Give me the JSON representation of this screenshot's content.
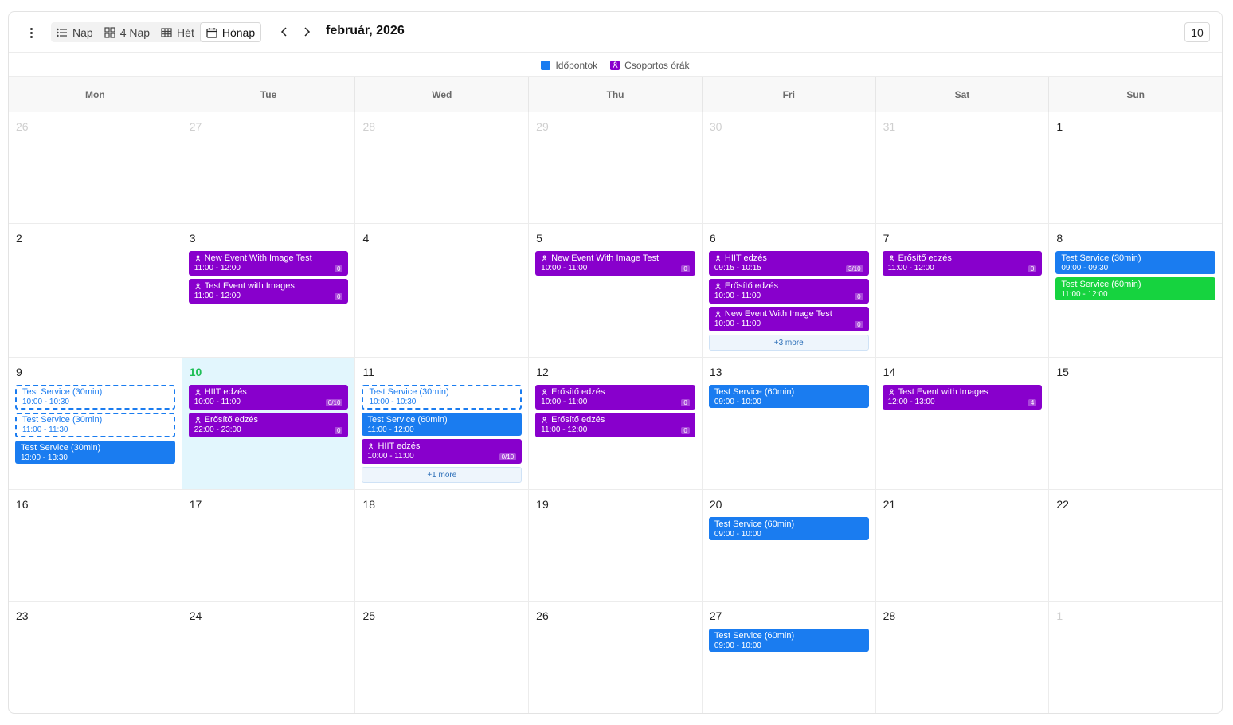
{
  "toolbar": {
    "menu_icon": "kebab-menu-icon",
    "views": [
      {
        "label": "Nap",
        "icon": "list-icon",
        "active": false
      },
      {
        "label": "4 Nap",
        "icon": "grid-icon",
        "active": false
      },
      {
        "label": "Hét",
        "icon": "table-icon",
        "active": false
      },
      {
        "label": "Hónap",
        "icon": "calendar-icon",
        "active": true
      }
    ],
    "prev_icon": "chevron-left-icon",
    "next_icon": "chevron-right-icon",
    "title": "február, 2026",
    "today_label": "10"
  },
  "legend": [
    {
      "label": "Időpontok",
      "color": "#1a7cf0",
      "icon": ""
    },
    {
      "label": "Csoportos órák",
      "color": "#8800cc",
      "icon": "person-icon"
    }
  ],
  "colors": {
    "appointment": "#1a7cf0",
    "group": "#8800cc",
    "green": "#16d33f",
    "today_bg": "#e2f6fd",
    "today_num": "#1fbf57"
  },
  "day_headers": [
    "Mon",
    "Tue",
    "Wed",
    "Thu",
    "Fri",
    "Sat",
    "Sun"
  ],
  "weeks": [
    {
      "days": [
        {
          "num": "26",
          "outside": true,
          "events": []
        },
        {
          "num": "27",
          "outside": true,
          "events": []
        },
        {
          "num": "28",
          "outside": true,
          "events": []
        },
        {
          "num": "29",
          "outside": true,
          "events": []
        },
        {
          "num": "30",
          "outside": true,
          "events": []
        },
        {
          "num": "31",
          "outside": true,
          "events": []
        },
        {
          "num": "1",
          "events": []
        }
      ]
    },
    {
      "days": [
        {
          "num": "2",
          "events": []
        },
        {
          "num": "3",
          "events": [
            {
              "title": "New Event With Image Test",
              "time": "11:00 - 12:00",
              "type": "purple",
              "count": "0"
            },
            {
              "title": "Test Event with Images",
              "time": "11:00 - 12:00",
              "type": "purple",
              "count": "0"
            }
          ]
        },
        {
          "num": "4",
          "events": []
        },
        {
          "num": "5",
          "events": [
            {
              "title": "New Event With Image Test",
              "time": "10:00 - 11:00",
              "type": "purple",
              "count": "0"
            }
          ]
        },
        {
          "num": "6",
          "events": [
            {
              "title": "HIIT edzés",
              "time": "09:15 - 10:15",
              "type": "purple",
              "count": "3/10"
            },
            {
              "title": "Erősítő edzés",
              "time": "10:00 - 11:00",
              "type": "purple",
              "count": "0"
            },
            {
              "title": "New Event With Image Test",
              "time": "10:00 - 11:00",
              "type": "purple",
              "count": "0"
            }
          ],
          "more": "+3 more"
        },
        {
          "num": "7",
          "events": [
            {
              "title": "Erősítő edzés",
              "time": "11:00 - 12:00",
              "type": "purple",
              "count": "0"
            }
          ]
        },
        {
          "num": "8",
          "events": [
            {
              "title": "Test Service (30min)",
              "time": "09:00 - 09:30",
              "type": "blue"
            },
            {
              "title": "Test Service (60min)",
              "time": "11:00 - 12:00",
              "type": "green"
            }
          ]
        }
      ]
    },
    {
      "days": [
        {
          "num": "9",
          "events": [
            {
              "title": "Test Service (30min)",
              "time": "10:00 - 10:30",
              "type": "dashed"
            },
            {
              "title": "Test Service (30min)",
              "time": "11:00 - 11:30",
              "type": "dashed"
            },
            {
              "title": "Test Service (30min)",
              "time": "13:00 - 13:30",
              "type": "blue"
            }
          ]
        },
        {
          "num": "10",
          "today": true,
          "events": [
            {
              "title": "HIIT edzés",
              "time": "10:00 - 11:00",
              "type": "purple",
              "count": "0/10"
            },
            {
              "title": "Erősítő edzés",
              "time": "22:00 - 23:00",
              "type": "purple",
              "count": "0"
            }
          ]
        },
        {
          "num": "11",
          "events": [
            {
              "title": "Test Service (30min)",
              "time": "10:00 - 10:30",
              "type": "dashed"
            },
            {
              "title": "Test Service (60min)",
              "time": "11:00 - 12:00",
              "type": "blue"
            },
            {
              "title": "HIIT edzés",
              "time": "10:00 - 11:00",
              "type": "purple",
              "count": "0/10"
            }
          ],
          "more": "+1 more"
        },
        {
          "num": "12",
          "events": [
            {
              "title": "Erősítő edzés",
              "time": "10:00 - 11:00",
              "type": "purple",
              "count": "0"
            },
            {
              "title": "Erősítő edzés",
              "time": "11:00 - 12:00",
              "type": "purple",
              "count": "0"
            }
          ]
        },
        {
          "num": "13",
          "events": [
            {
              "title": "Test Service (60min)",
              "time": "09:00 - 10:00",
              "type": "blue"
            }
          ]
        },
        {
          "num": "14",
          "events": [
            {
              "title": "Test Event with Images",
              "time": "12:00 - 13:00",
              "type": "purple",
              "count": "4"
            }
          ]
        },
        {
          "num": "15",
          "events": []
        }
      ]
    },
    {
      "days": [
        {
          "num": "16",
          "events": []
        },
        {
          "num": "17",
          "events": []
        },
        {
          "num": "18",
          "events": []
        },
        {
          "num": "19",
          "events": []
        },
        {
          "num": "20",
          "events": [
            {
              "title": "Test Service (60min)",
              "time": "09:00 - 10:00",
              "type": "blue"
            }
          ]
        },
        {
          "num": "21",
          "events": []
        },
        {
          "num": "22",
          "events": []
        }
      ]
    },
    {
      "days": [
        {
          "num": "23",
          "events": []
        },
        {
          "num": "24",
          "events": []
        },
        {
          "num": "25",
          "events": []
        },
        {
          "num": "26",
          "events": []
        },
        {
          "num": "27",
          "events": [
            {
              "title": "Test Service (60min)",
              "time": "09:00 - 10:00",
              "type": "blue"
            }
          ]
        },
        {
          "num": "28",
          "events": []
        },
        {
          "num": "1",
          "outside": true,
          "events": []
        }
      ]
    }
  ]
}
